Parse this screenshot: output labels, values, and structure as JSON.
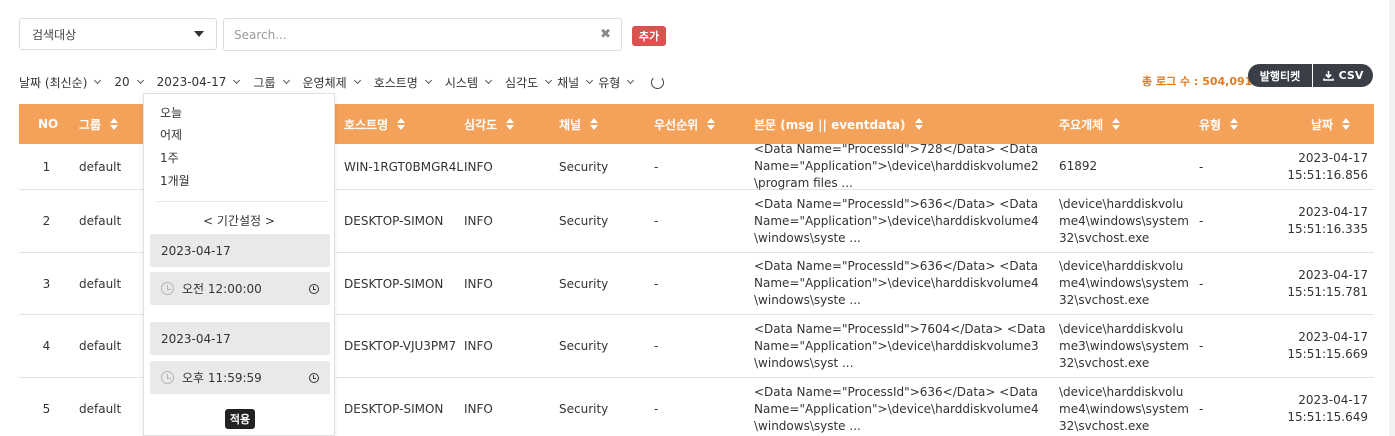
{
  "colors": {
    "accent": "#f4a15a",
    "add_button": "#d9534f",
    "total_text": "#e07b20",
    "dark_button": "#3a3f47"
  },
  "search": {
    "scope_label": "검색대상",
    "placeholder": "Search...",
    "clear_icon": "✖",
    "add_label": "추가"
  },
  "filters": [
    {
      "label": "날짜 (최신순)"
    },
    {
      "label": "20"
    },
    {
      "label": "2023-04-17"
    },
    {
      "label": "그룹"
    },
    {
      "label": "운영체제"
    },
    {
      "label": "호스트명"
    },
    {
      "label": "시스템"
    },
    {
      "label": "심각도"
    },
    {
      "label": "채널"
    },
    {
      "label": "유형"
    }
  ],
  "summary": {
    "total_label": "총 로그 수 : 504,091",
    "ticket_label": "발행티켓",
    "csv_label": "CSV"
  },
  "table": {
    "columns": {
      "no": "NO",
      "group": "그룹",
      "host": "호스트명",
      "severity": "심각도",
      "channel": "채널",
      "priority": "우선순위",
      "body": "본문 (msg || eventdata)",
      "entity": "주요개체",
      "type": "유형",
      "date": "날짜"
    },
    "rows": [
      {
        "no": "1",
        "group": "default",
        "host": "WIN-1RGT0BMGR4L",
        "severity": "INFO",
        "channel": "Security",
        "priority": "-",
        "body": "<Data Name=\"ProcessId\">728</Data> <Data Name=\"Application\">\\device\\harddiskvolume2\\program files ...",
        "entity": "61892",
        "type": "-",
        "date": "2023-04-17",
        "time": "15:51:16.856"
      },
      {
        "no": "2",
        "group": "default",
        "host": "DESKTOP-SIMON",
        "severity": "INFO",
        "channel": "Security",
        "priority": "-",
        "body": "<Data Name=\"ProcessId\">636</Data> <Data Name=\"Application\">\\device\\harddiskvolume4\\windows\\syste ...",
        "entity": "\\device\\harddiskvolume4\\windows\\system32\\svchost.exe",
        "type": "-",
        "date": "2023-04-17",
        "time": "15:51:16.335"
      },
      {
        "no": "3",
        "group": "default",
        "host": "DESKTOP-SIMON",
        "severity": "INFO",
        "channel": "Security",
        "priority": "-",
        "body": "<Data Name=\"ProcessId\">636</Data> <Data Name=\"Application\">\\device\\harddiskvolume4\\windows\\syste ...",
        "entity": "\\device\\harddiskvolume4\\windows\\system32\\svchost.exe",
        "type": "-",
        "date": "2023-04-17",
        "time": "15:51:15.781"
      },
      {
        "no": "4",
        "group": "default",
        "host": "DESKTOP-VJU3PM7",
        "severity": "INFO",
        "channel": "Security",
        "priority": "-",
        "body": "<Data Name=\"ProcessId\">7604</Data> <Data Name=\"Application\">\\device\\harddiskvolume3\\windows\\syst ...",
        "entity": "\\device\\harddiskvolume3\\windows\\system32\\svchost.exe",
        "type": "-",
        "date": "2023-04-17",
        "time": "15:51:15.669"
      },
      {
        "no": "5",
        "group": "default",
        "host": "DESKTOP-SIMON",
        "severity": "INFO",
        "channel": "Security",
        "priority": "-",
        "body": "<Data Name=\"ProcessId\">636</Data> <Data Name=\"Application\">\\device\\harddiskvolume4\\windows\\syste ...",
        "entity": "\\device\\harddiskvolume4\\windows\\system32\\svchost.exe",
        "type": "-",
        "date": "2023-04-17",
        "time": "15:51:15.649"
      }
    ]
  },
  "date_panel": {
    "quick_options": [
      "오늘",
      "어제",
      "1주",
      "1개월"
    ],
    "range_title": "< 기간설정 >",
    "start_date": "2023-04-17",
    "start_time": "오전 12:00:00",
    "end_date": "2023-04-17",
    "end_time": "오후 11:59:59",
    "apply_label": "적용"
  }
}
